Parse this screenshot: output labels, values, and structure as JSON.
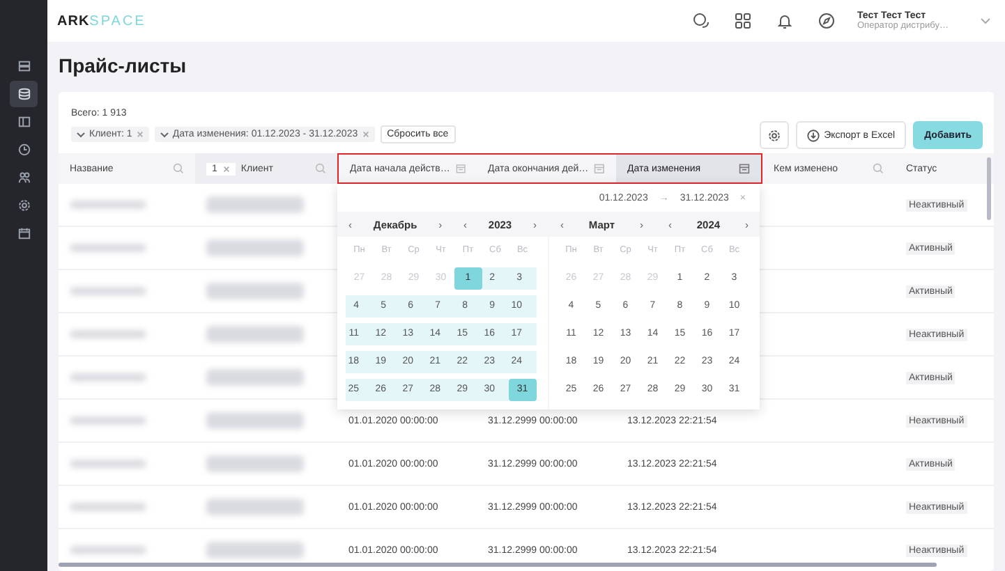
{
  "logo": {
    "primary": "ARK",
    "secondary": "SPACE"
  },
  "user": {
    "name": "Тест Тест Тест",
    "role": "Оператор дистрибу…"
  },
  "sidebar": {
    "items": [
      {
        "selected": false
      },
      {
        "selected": true
      },
      {
        "selected": false
      },
      {
        "selected": false
      },
      {
        "selected": false
      },
      {
        "selected": false
      },
      {
        "selected": false
      }
    ]
  },
  "page_title": "Прайс-листы",
  "total": "Всего: 1 913",
  "filters": [
    {
      "label": "Клиент: 1"
    },
    {
      "label": "Дата изменения: 01.12.2023 - 31.12.2023"
    }
  ],
  "reset_button": "Сбросить все",
  "export_button": "Экспорт в Excel",
  "add_button": "Добавить",
  "columns": [
    {
      "label": "Название",
      "kind": "search",
      "highlighted": false,
      "active": false
    },
    {
      "label": "Клиент",
      "kind": "search",
      "badge": "1",
      "highlighted": false,
      "active": false
    },
    {
      "label": "Дата начала действ…",
      "kind": "date",
      "highlighted": true,
      "active": false
    },
    {
      "label": "Дата окончания дей…",
      "kind": "date",
      "highlighted": true,
      "active": false
    },
    {
      "label": "Дата изменения",
      "kind": "date",
      "highlighted": true,
      "active": true
    },
    {
      "label": "Кем изменено",
      "kind": "search",
      "highlighted": false,
      "active": false
    },
    {
      "label": "Статус",
      "kind": "plain",
      "highlighted": false,
      "active": false
    }
  ],
  "rows": [
    {
      "status": "Неактивный"
    },
    {
      "status": "Активный"
    },
    {
      "status": "Активный"
    },
    {
      "status": "Неактивный"
    },
    {
      "status": "Активный"
    },
    {
      "start": "01.01.2020 00:00:00",
      "end": "31.12.2999 00:00:00",
      "changed": "13.12.2023 22:21:54",
      "status": "Неактивный"
    },
    {
      "start": "01.01.2020 00:00:00",
      "end": "31.12.2999 00:00:00",
      "changed": "13.12.2023 22:21:54",
      "status": "Активный"
    },
    {
      "start": "01.01.2020 00:00:00",
      "end": "31.12.2999 00:00:00",
      "changed": "13.12.2023 22:21:54",
      "status": "Неактивный"
    },
    {
      "start": "01.01.2020 00:00:00",
      "end": "31.12.2999 00:00:00",
      "changed": "13.12.2023 22:21:54",
      "status": "Неактивный"
    }
  ],
  "date_picker": {
    "from": "01.12.2023",
    "arrow": "→",
    "to": "31.12.2023",
    "clear": "×",
    "months": [
      {
        "prev_month": "‹",
        "month": "Декабрь",
        "next_month": "›",
        "prev_year": "‹",
        "year": "2023",
        "next_year": "›",
        "weekdays": [
          "Пн",
          "Вт",
          "Ср",
          "Чт",
          "Пт",
          "Сб",
          "Вс"
        ],
        "days": [
          {
            "label": "27",
            "kind": "other"
          },
          {
            "label": "28",
            "kind": "other"
          },
          {
            "label": "29",
            "kind": "other"
          },
          {
            "label": "30",
            "kind": "other"
          },
          {
            "label": "1",
            "kind": "edge"
          },
          {
            "label": "2",
            "kind": "range"
          },
          {
            "label": "3",
            "kind": "range"
          },
          {
            "label": "4",
            "kind": "range"
          },
          {
            "label": "5",
            "kind": "range"
          },
          {
            "label": "6",
            "kind": "range"
          },
          {
            "label": "7",
            "kind": "range"
          },
          {
            "label": "8",
            "kind": "range"
          },
          {
            "label": "9",
            "kind": "range"
          },
          {
            "label": "10",
            "kind": "range"
          },
          {
            "label": "11",
            "kind": "range"
          },
          {
            "label": "12",
            "kind": "range"
          },
          {
            "label": "13",
            "kind": "range"
          },
          {
            "label": "14",
            "kind": "range"
          },
          {
            "label": "15",
            "kind": "range"
          },
          {
            "label": "16",
            "kind": "range"
          },
          {
            "label": "17",
            "kind": "range"
          },
          {
            "label": "18",
            "kind": "range"
          },
          {
            "label": "19",
            "kind": "range"
          },
          {
            "label": "20",
            "kind": "range"
          },
          {
            "label": "21",
            "kind": "range"
          },
          {
            "label": "22",
            "kind": "range"
          },
          {
            "label": "23",
            "kind": "range"
          },
          {
            "label": "24",
            "kind": "range"
          },
          {
            "label": "25",
            "kind": "range"
          },
          {
            "label": "26",
            "kind": "range"
          },
          {
            "label": "27",
            "kind": "range"
          },
          {
            "label": "28",
            "kind": "range"
          },
          {
            "label": "29",
            "kind": "range"
          },
          {
            "label": "30",
            "kind": "range"
          },
          {
            "label": "31",
            "kind": "edge"
          }
        ]
      },
      {
        "prev_month": "‹",
        "month": "Март",
        "next_month": "›",
        "prev_year": "‹",
        "year": "2024",
        "next_year": "›",
        "weekdays": [
          "Пн",
          "Вт",
          "Ср",
          "Чт",
          "Пт",
          "Сб",
          "Вс"
        ],
        "days": [
          {
            "label": "26",
            "kind": "other"
          },
          {
            "label": "27",
            "kind": "other"
          },
          {
            "label": "28",
            "kind": "other"
          },
          {
            "label": "29",
            "kind": "other"
          },
          {
            "label": "1",
            "kind": "normal"
          },
          {
            "label": "2",
            "kind": "normal"
          },
          {
            "label": "3",
            "kind": "normal"
          },
          {
            "label": "4",
            "kind": "normal"
          },
          {
            "label": "5",
            "kind": "normal"
          },
          {
            "label": "6",
            "kind": "normal"
          },
          {
            "label": "7",
            "kind": "normal"
          },
          {
            "label": "8",
            "kind": "normal"
          },
          {
            "label": "9",
            "kind": "normal"
          },
          {
            "label": "10",
            "kind": "normal"
          },
          {
            "label": "11",
            "kind": "normal"
          },
          {
            "label": "12",
            "kind": "normal"
          },
          {
            "label": "13",
            "kind": "normal"
          },
          {
            "label": "14",
            "kind": "normal"
          },
          {
            "label": "15",
            "kind": "normal"
          },
          {
            "label": "16",
            "kind": "normal"
          },
          {
            "label": "17",
            "kind": "normal"
          },
          {
            "label": "18",
            "kind": "normal"
          },
          {
            "label": "19",
            "kind": "normal"
          },
          {
            "label": "20",
            "kind": "normal"
          },
          {
            "label": "21",
            "kind": "normal"
          },
          {
            "label": "22",
            "kind": "normal"
          },
          {
            "label": "23",
            "kind": "normal"
          },
          {
            "label": "24",
            "kind": "normal"
          },
          {
            "label": "25",
            "kind": "normal"
          },
          {
            "label": "26",
            "kind": "normal"
          },
          {
            "label": "27",
            "kind": "normal"
          },
          {
            "label": "28",
            "kind": "normal"
          },
          {
            "label": "29",
            "kind": "normal"
          },
          {
            "label": "30",
            "kind": "normal"
          },
          {
            "label": "31",
            "kind": "normal"
          }
        ]
      }
    ]
  }
}
